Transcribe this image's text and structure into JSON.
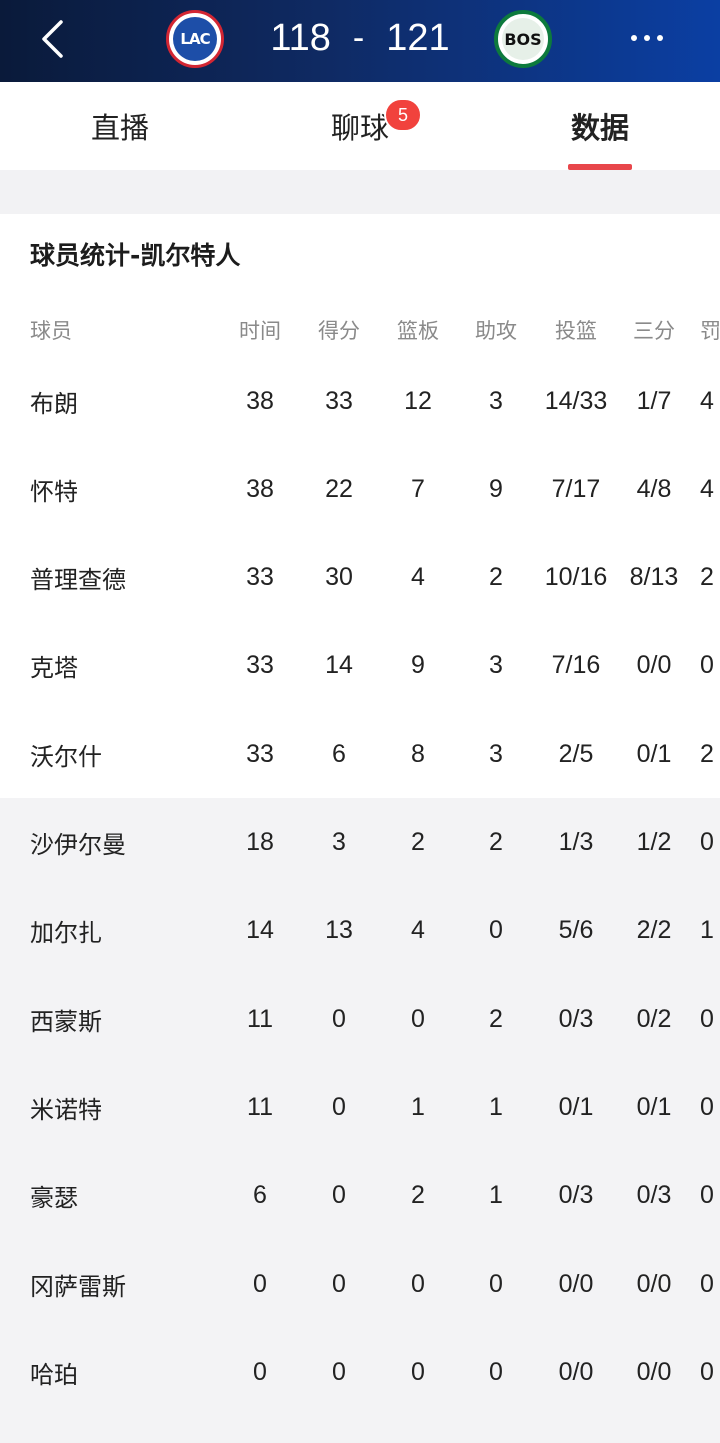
{
  "header": {
    "home_team": "LAC",
    "away_team": "BOS",
    "home_score": "118",
    "separator": "-",
    "away_score": "121",
    "colors": {
      "bar_start": "#0a1a3a",
      "bar_end": "#0b3fa3",
      "lac_red": "#d22633",
      "lac_blue": "#1d4ea8",
      "bos_green": "#0d7a3d"
    }
  },
  "tabs": [
    {
      "label": "直播"
    },
    {
      "label": "聊球",
      "badge": "5"
    },
    {
      "label": "数据",
      "active": true
    }
  ],
  "accent_color": "#e8464b",
  "stats": {
    "title": "球员统计-凯尔特人",
    "columns": [
      "球员",
      "时间",
      "得分",
      "篮板",
      "助攻",
      "投篮",
      "三分",
      "罚"
    ],
    "players": [
      {
        "name": "布朗",
        "min": "38",
        "pts": "33",
        "reb": "12",
        "ast": "3",
        "fg": "14/33",
        "tp": "1/7",
        "ft": "4"
      },
      {
        "name": "怀特",
        "min": "38",
        "pts": "22",
        "reb": "7",
        "ast": "9",
        "fg": "7/17",
        "tp": "4/8",
        "ft": "4"
      },
      {
        "name": "普理查德",
        "min": "33",
        "pts": "30",
        "reb": "4",
        "ast": "2",
        "fg": "10/16",
        "tp": "8/13",
        "ft": "2"
      },
      {
        "name": "克塔",
        "min": "33",
        "pts": "14",
        "reb": "9",
        "ast": "3",
        "fg": "7/16",
        "tp": "0/0",
        "ft": "0"
      },
      {
        "name": "沃尔什",
        "min": "33",
        "pts": "6",
        "reb": "8",
        "ast": "3",
        "fg": "2/5",
        "tp": "0/1",
        "ft": "2"
      },
      {
        "name": "沙伊尔曼",
        "min": "18",
        "pts": "3",
        "reb": "2",
        "ast": "2",
        "fg": "1/3",
        "tp": "1/2",
        "ft": "0"
      },
      {
        "name": "加尔扎",
        "min": "14",
        "pts": "13",
        "reb": "4",
        "ast": "0",
        "fg": "5/6",
        "tp": "2/2",
        "ft": "1"
      },
      {
        "name": "西蒙斯",
        "min": "11",
        "pts": "0",
        "reb": "0",
        "ast": "2",
        "fg": "0/3",
        "tp": "0/2",
        "ft": "0"
      },
      {
        "name": "米诺特",
        "min": "11",
        "pts": "0",
        "reb": "1",
        "ast": "1",
        "fg": "0/1",
        "tp": "0/1",
        "ft": "0"
      },
      {
        "name": "豪瑟",
        "min": "6",
        "pts": "0",
        "reb": "2",
        "ast": "1",
        "fg": "0/3",
        "tp": "0/3",
        "ft": "0"
      },
      {
        "name": "冈萨雷斯",
        "min": "0",
        "pts": "0",
        "reb": "0",
        "ast": "0",
        "fg": "0/0",
        "tp": "0/0",
        "ft": "0"
      },
      {
        "name": "哈珀",
        "min": "0",
        "pts": "0",
        "reb": "0",
        "ast": "0",
        "fg": "0/0",
        "tp": "0/0",
        "ft": "0"
      }
    ]
  }
}
